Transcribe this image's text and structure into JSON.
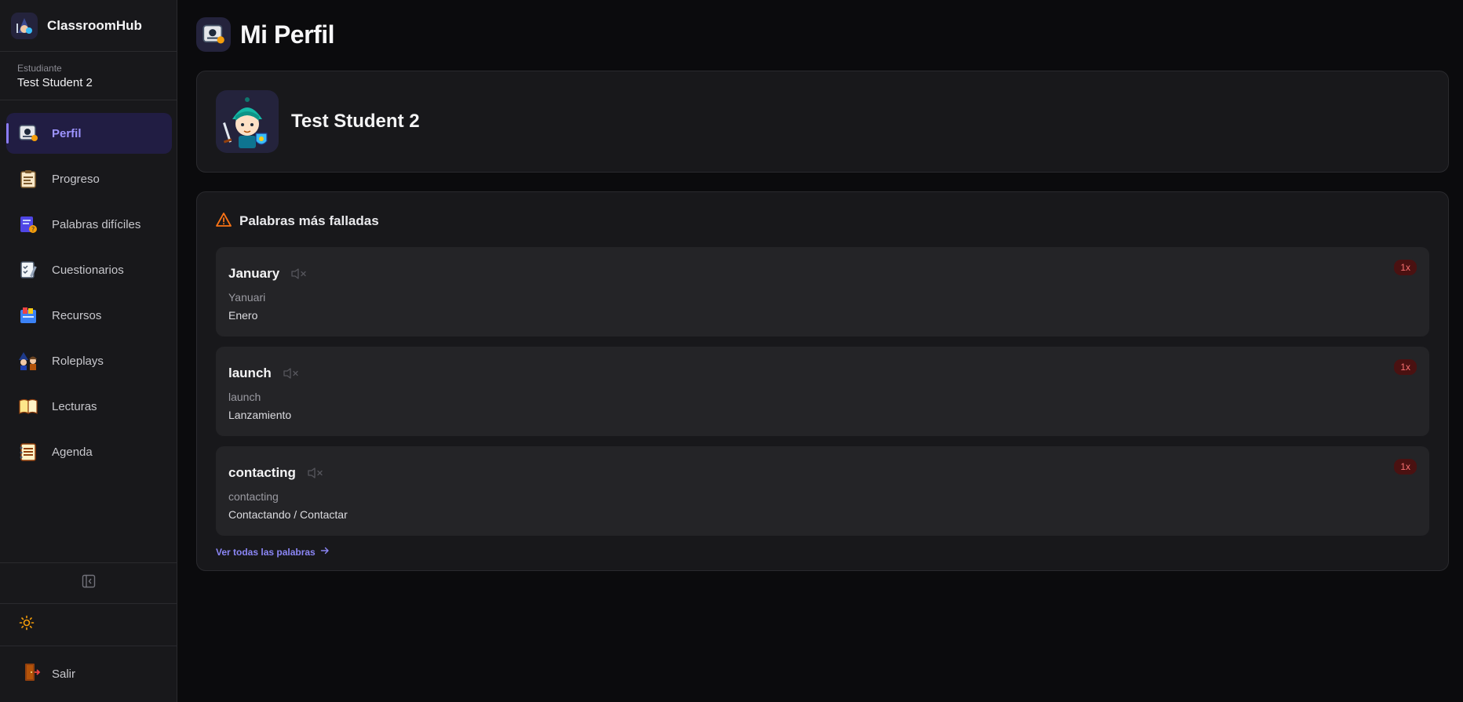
{
  "app": {
    "name": "ClassroomHub"
  },
  "user": {
    "role": "Estudiante",
    "name": "Test Student 2"
  },
  "nav": {
    "items": [
      {
        "label": "Perfil",
        "icon": "profile-id-icon",
        "active": true
      },
      {
        "label": "Progreso",
        "icon": "progress-clipboard-icon",
        "active": false
      },
      {
        "label": "Palabras difíciles",
        "icon": "difficult-words-icon",
        "active": false
      },
      {
        "label": "Cuestionarios",
        "icon": "quiz-icon",
        "active": false
      },
      {
        "label": "Recursos",
        "icon": "resources-icon",
        "active": false
      },
      {
        "label": "Roleplays",
        "icon": "roleplay-icon",
        "active": false
      },
      {
        "label": "Lecturas",
        "icon": "book-icon",
        "active": false
      },
      {
        "label": "Agenda",
        "icon": "agenda-icon",
        "active": false
      }
    ],
    "logout_label": "Salir"
  },
  "page": {
    "title": "Mi Perfil"
  },
  "profile": {
    "name": "Test Student 2"
  },
  "words": {
    "title": "Palabras más falladas",
    "items": [
      {
        "term": "January",
        "pronunciation": "Yanuari",
        "translation": "Enero",
        "count": "1x"
      },
      {
        "term": "launch",
        "pronunciation": "launch",
        "translation": "Lanzamiento",
        "count": "1x"
      },
      {
        "term": "contacting",
        "pronunciation": "contacting",
        "translation": "Contactando / Contactar",
        "count": "1x"
      }
    ],
    "see_all_label": "Ver todas las palabras"
  },
  "colors": {
    "accent": "#8b7cf6",
    "active_bg": "#211d43",
    "warning": "#f97316",
    "badge_bg": "#4a1111",
    "badge_text": "#f87171"
  }
}
